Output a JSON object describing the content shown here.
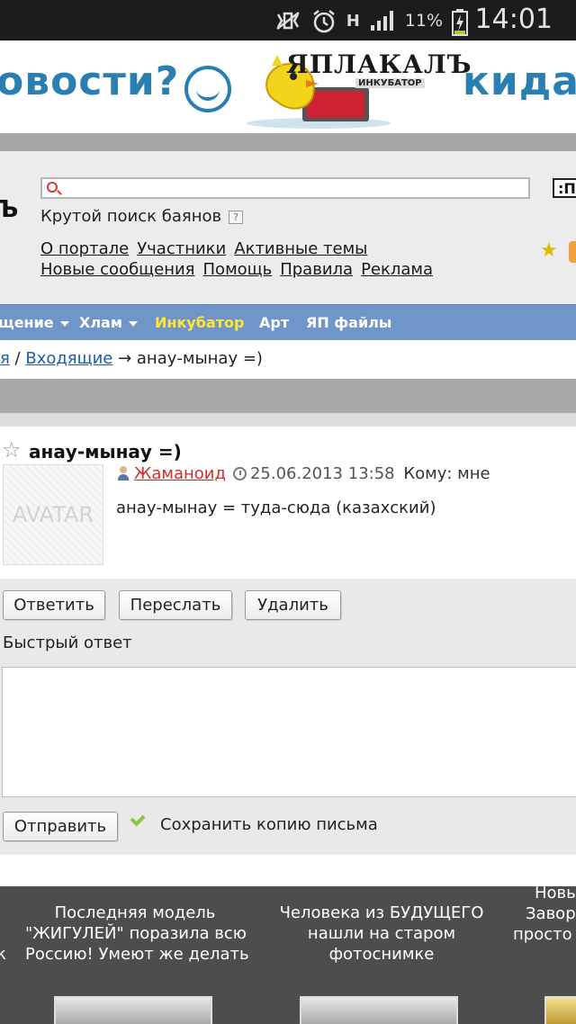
{
  "status_bar": {
    "battery": "11%",
    "network": "H",
    "time": "14:01"
  },
  "banner": {
    "left_text": "овости?",
    "logo_text": "ЯПЛАКАЛЪ",
    "logo_sub": "ИНКУБАТОР",
    "right_text": "кидай"
  },
  "header": {
    "logo_fragment": "Ъ",
    "search_placeholder": "",
    "search_button": ":П",
    "search_hint": "Крутой поиск баянов",
    "help": "?",
    "links_row1": [
      "О портале",
      "Участники",
      "Активные темы"
    ],
    "links_row2": [
      "Новые сообщения",
      "Помощь",
      "Правила",
      "Реклама"
    ]
  },
  "nav": {
    "items": [
      {
        "label": "щение"
      },
      {
        "label": "Хлам"
      },
      {
        "label": "Инкубатор"
      },
      {
        "label": "Арт"
      },
      {
        "label": "ЯП файлы"
      }
    ]
  },
  "breadcrumb": {
    "prev": "я",
    "sep": " / ",
    "inbox": "Входящие",
    "arrow": " → ",
    "current": "анау-мынау =)"
  },
  "message": {
    "title": "анау-мынау =)",
    "avatar": "AVATAR",
    "author": "Жаманоид",
    "date": "25.06.2013 13:58",
    "to": "Кому: мне",
    "body": "анау-мынау = туда-сюда (казахский)"
  },
  "actions": {
    "reply": "Ответить",
    "forward": "Переслать",
    "delete": "Удалить",
    "quick_reply": "Быстрый ответ",
    "send": "Отправить",
    "save_copy": "Сохранить копию письма"
  },
  "news": {
    "items": [
      {
        "lines": [
          "к"
        ]
      },
      {
        "lines": [
          "Последняя модель",
          "\"ЖИГУЛЕЙ\" поразила всю",
          "Россию! Умеют же делать"
        ]
      },
      {
        "lines": [
          "Человека из БУДУЩЕГО",
          "нашли на старом",
          "фотоснимке"
        ]
      },
      {
        "lines": [
          "Новы",
          "Завор",
          "просто"
        ]
      }
    ]
  }
}
